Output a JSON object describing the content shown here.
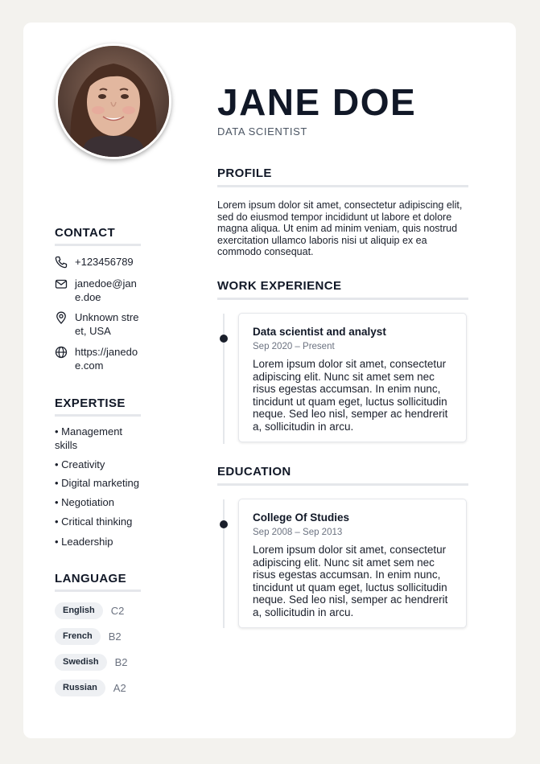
{
  "header": {
    "name": "JANE DOE",
    "role": "DATA SCIENTIST"
  },
  "contact": {
    "heading": "CONTACT",
    "items": [
      {
        "icon": "phone-icon",
        "text": "+123456789"
      },
      {
        "icon": "mail-icon",
        "text": "janedoe@jane.doe"
      },
      {
        "icon": "location-pin-icon",
        "text": "Unknown street, USA"
      },
      {
        "icon": "globe-icon",
        "text": "https://janedoe.com"
      }
    ]
  },
  "expertise": {
    "heading": "EXPERTISE",
    "items": [
      "• Management skills",
      "• Creativity",
      "• Digital marketing",
      "• Negotiation",
      "• Critical thinking",
      "• Leadership"
    ]
  },
  "language": {
    "heading": "LANGUAGE",
    "items": [
      {
        "name": "English",
        "level": "C2"
      },
      {
        "name": "French",
        "level": "B2"
      },
      {
        "name": "Swedish",
        "level": "B2"
      },
      {
        "name": "Russian",
        "level": "A2"
      }
    ]
  },
  "profile": {
    "heading": "PROFILE",
    "text": "Lorem ipsum dolor sit amet, consectetur adipiscing elit, sed do eiusmod tempor incididunt ut labore et dolore magna aliqua. Ut enim ad minim veniam, quis nostrud exercitation ullamco laboris nisi ut aliquip ex ea commodo consequat."
  },
  "work": {
    "heading": "WORK EXPERIENCE",
    "entries": [
      {
        "title": "Data scientist and analyst",
        "date": "Sep 2020 – Present",
        "description": "Lorem ipsum dolor sit amet, consectetur adipiscing elit. Nunc sit amet sem nec risus egestas accumsan. In enim nunc, tincidunt ut quam eget, luctus sollicitudin neque. Sed leo nisl, semper ac hendrerit a, sollicitudin in arcu."
      }
    ]
  },
  "education": {
    "heading": "EDUCATION",
    "entries": [
      {
        "title": "College Of Studies",
        "date": "Sep 2008 – Sep 2013",
        "description": "Lorem ipsum dolor sit amet, consectetur adipiscing elit. Nunc sit amet sem nec risus egestas accumsan. In enim nunc, tincidunt ut quam eget, luctus sollicitudin neque. Sed leo nisl, semper ac hendrerit a, sollicitudin in arcu."
      }
    ]
  },
  "colors": {
    "page_background": "#f3f2ee",
    "card_background": "#ffffff",
    "text_dark": "#111827",
    "muted": "#6b7280",
    "divider": "#e5e7eb"
  }
}
